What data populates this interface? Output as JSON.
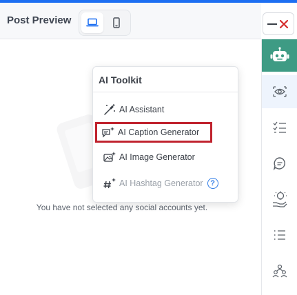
{
  "header": {
    "title": "Post Preview"
  },
  "device_toggle": {
    "desktop_icon": "laptop-icon",
    "mobile_icon": "mobile-phone-icon",
    "selected": "desktop"
  },
  "window_controls": {
    "minimize_icon": "minimize-icon",
    "close_icon": "close-icon",
    "close_color": "#d42a2a"
  },
  "preview": {
    "empty_message": "You have not selected any social accounts yet."
  },
  "ai_toolkit": {
    "title": "AI Toolkit",
    "items": [
      {
        "label": "AI Assistant",
        "icon": "magic-wand-icon"
      },
      {
        "label": "AI Caption Generator",
        "icon": "caption-sparkle-icon",
        "highlighted": true
      },
      {
        "label": "AI Image Generator",
        "icon": "image-sparkle-icon"
      },
      {
        "label": "AI Hashtag Generator",
        "icon": "hashtag-sparkle-icon",
        "disabled": true,
        "help_icon": "help-icon",
        "help_text": "?"
      }
    ]
  },
  "sidebar": {
    "items": [
      {
        "name": "ai-robot",
        "icon": "robot-icon",
        "color": "#3e9b84"
      },
      {
        "name": "preview",
        "icon": "eye-icon",
        "active": true
      },
      {
        "name": "checklist",
        "icon": "checklist-icon"
      },
      {
        "name": "comments",
        "icon": "chat-bubble-icon"
      },
      {
        "name": "ideas",
        "icon": "lightbulb-hand-icon"
      },
      {
        "name": "list",
        "icon": "list-icon"
      },
      {
        "name": "team",
        "icon": "team-icon"
      }
    ]
  },
  "colors": {
    "accent": "#1d6ff2",
    "highlight_border": "#c0232e",
    "sidebar_ai": "#3e9b84"
  }
}
